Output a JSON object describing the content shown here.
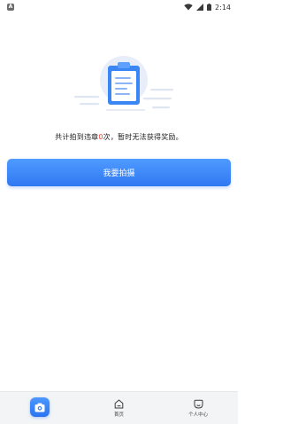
{
  "status_bar": {
    "app_indicator": "A",
    "time": "2:14",
    "icons": [
      "wifi-icon",
      "signal-icon",
      "battery-icon"
    ]
  },
  "illustration": {
    "icon": "clipboard-document-icon"
  },
  "summary": {
    "prefix": "共计拍到违章",
    "count": "0",
    "suffix": "次，暂时无法获得奖励。"
  },
  "primary_button": {
    "label": "我要拍摄"
  },
  "bottom_nav": {
    "items": [
      {
        "icon": "camera-icon",
        "label": ""
      },
      {
        "icon": "home-icon",
        "label": "首页"
      },
      {
        "icon": "profile-icon",
        "label": "个人中心"
      }
    ]
  },
  "colors": {
    "accent": "#2f78f2",
    "count_highlight": "#ff3b30",
    "nav_background": "#f2f4f6"
  }
}
